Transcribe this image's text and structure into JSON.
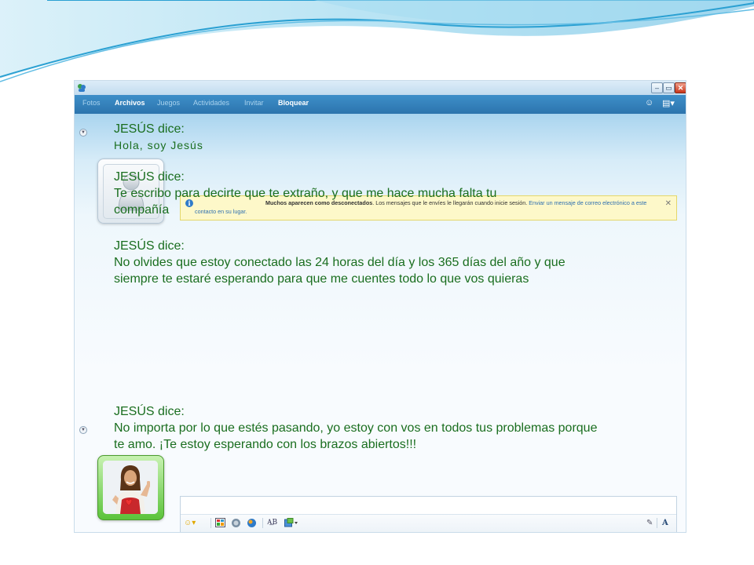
{
  "menu": {
    "items": [
      {
        "label": "Fotos",
        "active": false
      },
      {
        "label": "Archivos",
        "active": true
      },
      {
        "label": "Juegos",
        "active": false
      },
      {
        "label": "Actividades",
        "active": false
      },
      {
        "label": "Invitar",
        "active": false
      },
      {
        "label": "Bloquear",
        "active": true
      }
    ]
  },
  "notice": {
    "bold": "Muchos aparecen como desconectados",
    "text": ". Los mensajes que le envíes le llegarán cuando inicie sesión.",
    "link": "Enviar un mensaje de correo electrónico a este contacto en su lugar."
  },
  "messages": [
    {
      "who": "JESÚS dice:",
      "body": "Hola,  soy  Jesús"
    },
    {
      "who": "JESÚS dice:",
      "body": "Te escribo para decirte que te extraño, y que me hace mucha falta tu compañía"
    },
    {
      "who": "JESÚS dice:",
      "body": "No olvides que estoy conectado las 24 horas del día y los 365 días del año y que siempre te estaré esperando para que me cuentes todo lo que vos quieras"
    },
    {
      "who": "JESÚS dice:",
      "body": "No importa por lo que estés pasando, yo estoy con vos en todos tus problemas porque te amo. ¡Te estoy esperando con los brazos abiertos!!!"
    }
  ],
  "colors": {
    "message_text": "#1a6e1f",
    "menubar": "#2c74ad",
    "notice_bg": "#fdf8c9"
  },
  "icons": {
    "window": [
      "app-icon",
      "minimize-icon",
      "maximize-icon",
      "close-icon"
    ],
    "menubar": [
      "wink-icon",
      "menu-options-icon"
    ],
    "toolbar": [
      "emoticon-icon",
      "background-icon",
      "nudge-icon",
      "voice-clip-icon",
      "font-icon",
      "picture-icon",
      "handwriting-icon",
      "text-format-icon"
    ]
  }
}
